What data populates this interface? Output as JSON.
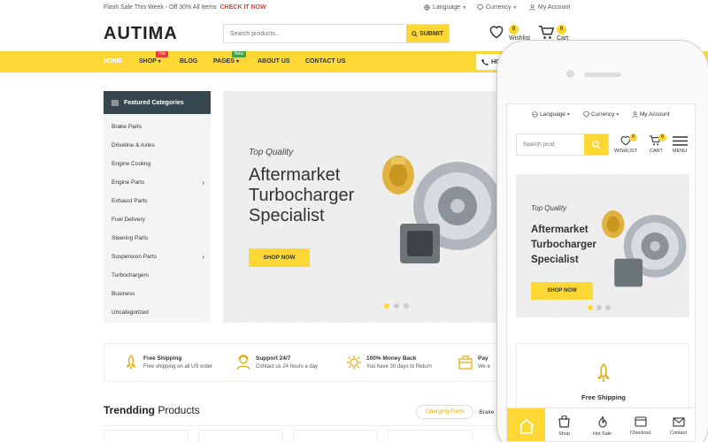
{
  "topbar": {
    "flash_text": "Flash Sale This Week - Off 30% All Items",
    "flash_link": "CHECK IT NOW",
    "language": "Language",
    "currency": "Currency",
    "account": "My Account"
  },
  "header": {
    "logo": "AUTIMA",
    "search_placeholder": "Search products...",
    "search_button": "SUBMIT",
    "wishlist_label": "Wishlist",
    "wishlist_count": "0",
    "cart_label": "Cart",
    "cart_count": "0"
  },
  "nav": {
    "items": [
      {
        "label": "HOME"
      },
      {
        "label": "SHOP",
        "tag": "Hot"
      },
      {
        "label": "BLOG"
      },
      {
        "label": "PAGES",
        "tag": "New"
      },
      {
        "label": "ABOUT US"
      },
      {
        "label": "CONTACT US"
      }
    ],
    "hotline_label": "HOT"
  },
  "categories": {
    "title": "Featured Categories",
    "items": [
      {
        "label": "Brake Parts",
        "has_sub": false
      },
      {
        "label": "Driveline & Axles",
        "has_sub": false
      },
      {
        "label": "Engine Cooling",
        "has_sub": false
      },
      {
        "label": "Engine Parts",
        "has_sub": true
      },
      {
        "label": "Exhaust Parts",
        "has_sub": false
      },
      {
        "label": "Fuel Delivery",
        "has_sub": false
      },
      {
        "label": "Steering Parts",
        "has_sub": false
      },
      {
        "label": "Suspension Parts",
        "has_sub": true
      },
      {
        "label": "Turbochargers",
        "has_sub": false
      },
      {
        "label": "Business",
        "has_sub": false
      },
      {
        "label": "Uncategorized",
        "has_sub": false
      }
    ]
  },
  "slider": {
    "subtitle": "Top Quality",
    "title": "Aftermarket Turbocharger Specialist",
    "button": "SHOP NOW",
    "active_slide": 1,
    "slide_count": 3
  },
  "services": [
    {
      "title": "Free Shipping",
      "desc": "Free shipping on all US order",
      "icon": "rocket-icon"
    },
    {
      "title": "Support 24/7",
      "desc": "Contact us 24 hours a day",
      "icon": "support-icon"
    },
    {
      "title": "100% Money Back",
      "desc": "You have 30 days to Return",
      "icon": "money-back-icon"
    },
    {
      "title": "Pay",
      "desc": "We e",
      "icon": "payment-icon"
    }
  ],
  "trending": {
    "title_bold": "Trendding",
    "title_rest": " Products",
    "tabs": [
      "Charging Parts",
      "Brake"
    ]
  },
  "mobile": {
    "language": "Language",
    "currency": "Currency",
    "account": "My Account",
    "search_placeholder": "Search prod",
    "wishlist_label": "WISHLIST",
    "wishlist_count": "0",
    "cart_label": "CART",
    "cart_count": "0",
    "menu_label": "MENU",
    "banner_subtitle": "Top Quality",
    "banner_title": "Aftermarket Turbocharger Specialist",
    "banner_button": "SHOP NOW",
    "service_title": "Free Shipping",
    "bottom_nav": [
      "Shop",
      "Hot Sale",
      "Checkout",
      "Contact"
    ]
  },
  "colors": {
    "accent": "#fdd835",
    "dark": "#37474f",
    "flash_red": "#e53935"
  }
}
